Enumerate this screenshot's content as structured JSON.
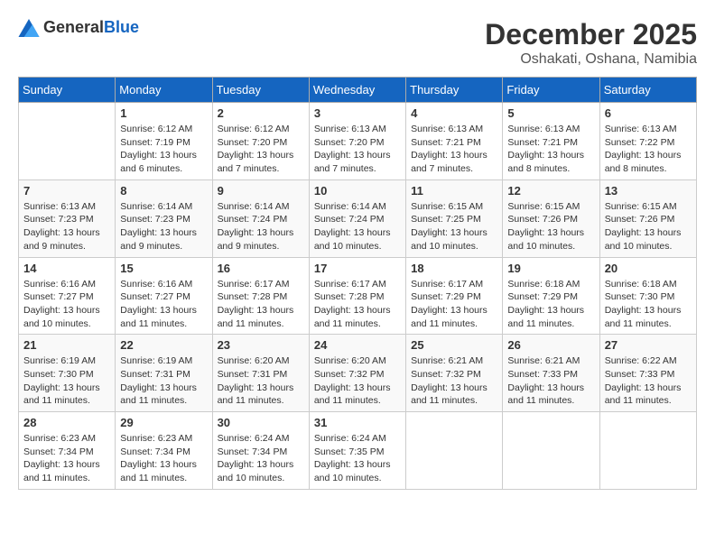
{
  "logo": {
    "general": "General",
    "blue": "Blue"
  },
  "title": "December 2025",
  "subtitle": "Oshakati, Oshana, Namibia",
  "headers": [
    "Sunday",
    "Monday",
    "Tuesday",
    "Wednesday",
    "Thursday",
    "Friday",
    "Saturday"
  ],
  "weeks": [
    [
      {
        "day": "",
        "info": ""
      },
      {
        "day": "1",
        "info": "Sunrise: 6:12 AM\nSunset: 7:19 PM\nDaylight: 13 hours\nand 6 minutes."
      },
      {
        "day": "2",
        "info": "Sunrise: 6:12 AM\nSunset: 7:20 PM\nDaylight: 13 hours\nand 7 minutes."
      },
      {
        "day": "3",
        "info": "Sunrise: 6:13 AM\nSunset: 7:20 PM\nDaylight: 13 hours\nand 7 minutes."
      },
      {
        "day": "4",
        "info": "Sunrise: 6:13 AM\nSunset: 7:21 PM\nDaylight: 13 hours\nand 7 minutes."
      },
      {
        "day": "5",
        "info": "Sunrise: 6:13 AM\nSunset: 7:21 PM\nDaylight: 13 hours\nand 8 minutes."
      },
      {
        "day": "6",
        "info": "Sunrise: 6:13 AM\nSunset: 7:22 PM\nDaylight: 13 hours\nand 8 minutes."
      }
    ],
    [
      {
        "day": "7",
        "info": "Sunrise: 6:13 AM\nSunset: 7:23 PM\nDaylight: 13 hours\nand 9 minutes."
      },
      {
        "day": "8",
        "info": "Sunrise: 6:14 AM\nSunset: 7:23 PM\nDaylight: 13 hours\nand 9 minutes."
      },
      {
        "day": "9",
        "info": "Sunrise: 6:14 AM\nSunset: 7:24 PM\nDaylight: 13 hours\nand 9 minutes."
      },
      {
        "day": "10",
        "info": "Sunrise: 6:14 AM\nSunset: 7:24 PM\nDaylight: 13 hours\nand 10 minutes."
      },
      {
        "day": "11",
        "info": "Sunrise: 6:15 AM\nSunset: 7:25 PM\nDaylight: 13 hours\nand 10 minutes."
      },
      {
        "day": "12",
        "info": "Sunrise: 6:15 AM\nSunset: 7:26 PM\nDaylight: 13 hours\nand 10 minutes."
      },
      {
        "day": "13",
        "info": "Sunrise: 6:15 AM\nSunset: 7:26 PM\nDaylight: 13 hours\nand 10 minutes."
      }
    ],
    [
      {
        "day": "14",
        "info": "Sunrise: 6:16 AM\nSunset: 7:27 PM\nDaylight: 13 hours\nand 10 minutes."
      },
      {
        "day": "15",
        "info": "Sunrise: 6:16 AM\nSunset: 7:27 PM\nDaylight: 13 hours\nand 11 minutes."
      },
      {
        "day": "16",
        "info": "Sunrise: 6:17 AM\nSunset: 7:28 PM\nDaylight: 13 hours\nand 11 minutes."
      },
      {
        "day": "17",
        "info": "Sunrise: 6:17 AM\nSunset: 7:28 PM\nDaylight: 13 hours\nand 11 minutes."
      },
      {
        "day": "18",
        "info": "Sunrise: 6:17 AM\nSunset: 7:29 PM\nDaylight: 13 hours\nand 11 minutes."
      },
      {
        "day": "19",
        "info": "Sunrise: 6:18 AM\nSunset: 7:29 PM\nDaylight: 13 hours\nand 11 minutes."
      },
      {
        "day": "20",
        "info": "Sunrise: 6:18 AM\nSunset: 7:30 PM\nDaylight: 13 hours\nand 11 minutes."
      }
    ],
    [
      {
        "day": "21",
        "info": "Sunrise: 6:19 AM\nSunset: 7:30 PM\nDaylight: 13 hours\nand 11 minutes."
      },
      {
        "day": "22",
        "info": "Sunrise: 6:19 AM\nSunset: 7:31 PM\nDaylight: 13 hours\nand 11 minutes."
      },
      {
        "day": "23",
        "info": "Sunrise: 6:20 AM\nSunset: 7:31 PM\nDaylight: 13 hours\nand 11 minutes."
      },
      {
        "day": "24",
        "info": "Sunrise: 6:20 AM\nSunset: 7:32 PM\nDaylight: 13 hours\nand 11 minutes."
      },
      {
        "day": "25",
        "info": "Sunrise: 6:21 AM\nSunset: 7:32 PM\nDaylight: 13 hours\nand 11 minutes."
      },
      {
        "day": "26",
        "info": "Sunrise: 6:21 AM\nSunset: 7:33 PM\nDaylight: 13 hours\nand 11 minutes."
      },
      {
        "day": "27",
        "info": "Sunrise: 6:22 AM\nSunset: 7:33 PM\nDaylight: 13 hours\nand 11 minutes."
      }
    ],
    [
      {
        "day": "28",
        "info": "Sunrise: 6:23 AM\nSunset: 7:34 PM\nDaylight: 13 hours\nand 11 minutes."
      },
      {
        "day": "29",
        "info": "Sunrise: 6:23 AM\nSunset: 7:34 PM\nDaylight: 13 hours\nand 11 minutes."
      },
      {
        "day": "30",
        "info": "Sunrise: 6:24 AM\nSunset: 7:34 PM\nDaylight: 13 hours\nand 10 minutes."
      },
      {
        "day": "31",
        "info": "Sunrise: 6:24 AM\nSunset: 7:35 PM\nDaylight: 13 hours\nand 10 minutes."
      },
      {
        "day": "",
        "info": ""
      },
      {
        "day": "",
        "info": ""
      },
      {
        "day": "",
        "info": ""
      }
    ]
  ]
}
